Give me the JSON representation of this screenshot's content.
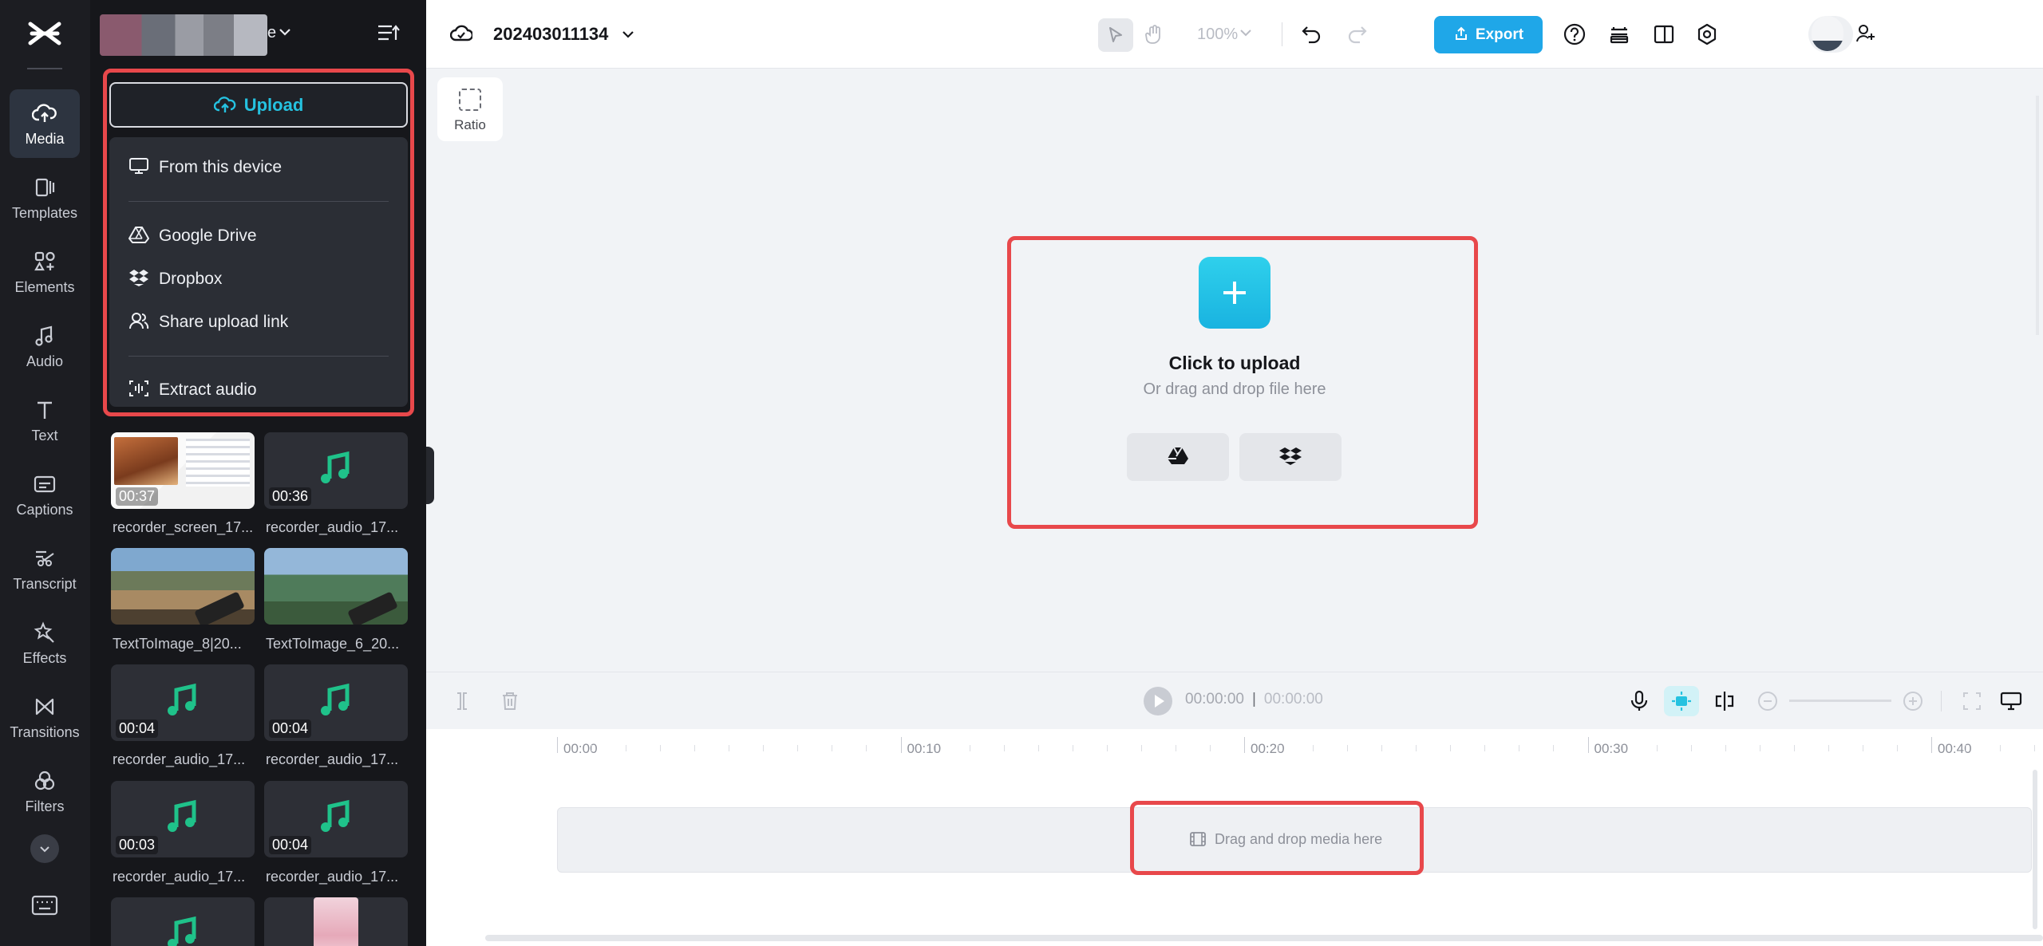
{
  "rail": {
    "items": [
      {
        "label": "Media",
        "icon": "cloud-upload-icon"
      },
      {
        "label": "Templates",
        "icon": "templates-icon"
      },
      {
        "label": "Elements",
        "icon": "elements-icon"
      },
      {
        "label": "Audio",
        "icon": "music-note-icon"
      },
      {
        "label": "Text",
        "icon": "text-icon"
      },
      {
        "label": "Captions",
        "icon": "captions-icon"
      },
      {
        "label": "Transcript",
        "icon": "transcript-icon"
      },
      {
        "label": "Effects",
        "icon": "effects-icon"
      },
      {
        "label": "Transitions",
        "icon": "transitions-icon"
      },
      {
        "label": "Filters",
        "icon": "filters-icon"
      }
    ]
  },
  "panel": {
    "project_suffix": "e",
    "upload_label": "Upload",
    "menu": {
      "device": "From this device",
      "gdrive": "Google Drive",
      "dropbox": "Dropbox",
      "share": "Share upload link",
      "extract": "Extract audio"
    },
    "media": [
      {
        "duration": "00:37",
        "name": "recorder_screen_17...",
        "kind": "screen"
      },
      {
        "duration": "00:36",
        "name": "recorder_audio_17...",
        "kind": "audio"
      },
      {
        "duration": "",
        "name": "TextToImage_8|20...",
        "kind": "image"
      },
      {
        "duration": "",
        "name": "TextToImage_6_20...",
        "kind": "image"
      },
      {
        "duration": "00:04",
        "name": "recorder_audio_17...",
        "kind": "audio"
      },
      {
        "duration": "00:04",
        "name": "recorder_audio_17...",
        "kind": "audio"
      },
      {
        "duration": "00:03",
        "name": "recorder_audio_17...",
        "kind": "audio"
      },
      {
        "duration": "00:04",
        "name": "recorder_audio_17...",
        "kind": "audio"
      }
    ]
  },
  "topbar": {
    "title": "202403011134",
    "zoom": "100%",
    "export_label": "Export"
  },
  "canvas": {
    "ratio_label": "Ratio",
    "upload_title": "Click to upload",
    "upload_sub": "Or drag and drop file here"
  },
  "timeline": {
    "current": "00:00:00",
    "total": "00:00:00",
    "ruler": [
      "00:00",
      "00:10",
      "00:20",
      "00:30",
      "00:40"
    ],
    "drop_hint": "Drag and drop media here"
  },
  "colors": {
    "accent": "#1fa7e8",
    "upload_cyan": "#25c2e0",
    "highlight": "#e8484b",
    "audio_green": "#1fc28a"
  }
}
